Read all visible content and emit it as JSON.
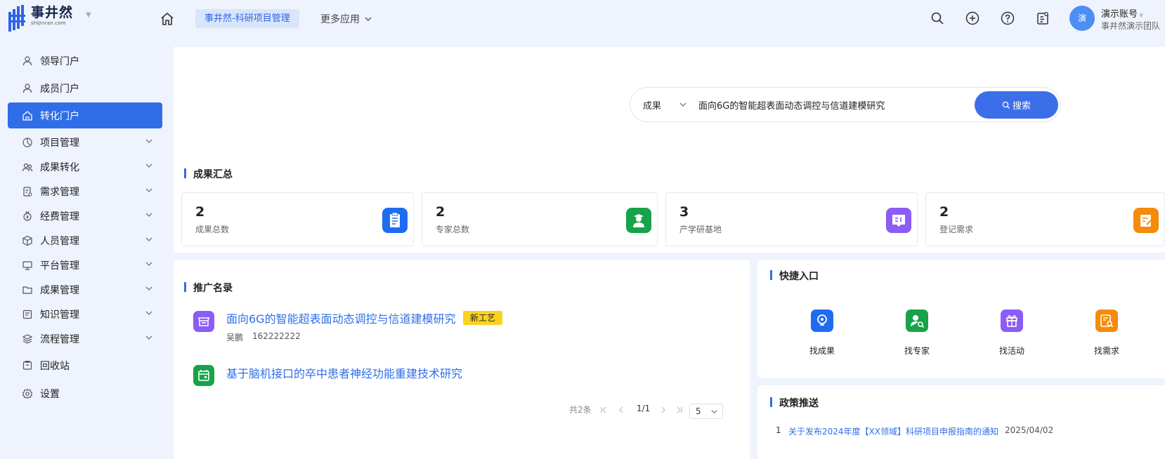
{
  "header": {
    "logo_cn": "事井然",
    "logo_en": "shijinran.com",
    "app_name": "事井然-科研项目管理",
    "more_apps": "更多应用",
    "avatar_text": "演",
    "account_name": "演示账号",
    "account_team": "事井然演示团队"
  },
  "sidebar": {
    "items": [
      {
        "label": "领导门户",
        "icon": "person-icon",
        "expandable": false,
        "active": false
      },
      {
        "label": "成员门户",
        "icon": "person-icon",
        "expandable": false,
        "active": false
      },
      {
        "label": "转化门户",
        "icon": "home-icon",
        "expandable": false,
        "active": true
      },
      {
        "label": "项目管理",
        "icon": "pie-icon",
        "expandable": true,
        "active": false
      },
      {
        "label": "成果转化",
        "icon": "group-icon",
        "expandable": true,
        "active": false
      },
      {
        "label": "需求管理",
        "icon": "doc-icon",
        "expandable": true,
        "active": false
      },
      {
        "label": "经费管理",
        "icon": "money-icon",
        "expandable": true,
        "active": false
      },
      {
        "label": "人员管理",
        "icon": "cube-icon",
        "expandable": true,
        "active": false
      },
      {
        "label": "平台管理",
        "icon": "monitor-icon",
        "expandable": true,
        "active": false
      },
      {
        "label": "成果管理",
        "icon": "folder-icon",
        "expandable": true,
        "active": false
      },
      {
        "label": "知识管理",
        "icon": "book-icon",
        "expandable": true,
        "active": false
      },
      {
        "label": "流程管理",
        "icon": "layers-icon",
        "expandable": true,
        "active": false
      },
      {
        "label": "回收站",
        "icon": "trash-icon",
        "expandable": false,
        "active": false
      },
      {
        "label": "设置",
        "icon": "gear-icon",
        "expandable": false,
        "active": false
      }
    ]
  },
  "search": {
    "category": "成果",
    "query": "面向6G的智能超表面动态调控与信道建模研究",
    "button_label": "搜索"
  },
  "summary": {
    "title": "成果汇总",
    "cards": [
      {
        "value": "2",
        "label": "成果总数",
        "color": "#1f6cf0",
        "icon": "clipboard-icon"
      },
      {
        "value": "2",
        "label": "专家总数",
        "color": "#17a34a",
        "icon": "expert-icon"
      },
      {
        "value": "3",
        "label": "产学研基地",
        "color": "#8b5cf6",
        "icon": "base-icon"
      },
      {
        "value": "2",
        "label": "登记需求",
        "color": "#f58a0b",
        "icon": "edit-icon"
      }
    ]
  },
  "promotion": {
    "title": "推广名录",
    "items": [
      {
        "title": "面向6G的智能超表面动态调控与信道建模研究",
        "tag": "新工艺",
        "author": "吴鹏",
        "phone": "162222222",
        "color": "#8b5cf6",
        "icon": "store-icon"
      },
      {
        "title": "基于脑机接口的卒中患者神经功能重建技术研究",
        "tag": "",
        "author": "",
        "phone": "",
        "color": "#17a34a",
        "icon": "calendar-icon"
      }
    ],
    "pager": {
      "total": "共2条",
      "page": "1/1",
      "size": "5"
    }
  },
  "quick": {
    "title": "快捷入口",
    "items": [
      {
        "label": "找成果",
        "color": "#1f6cf0",
        "icon": "bulb-icon"
      },
      {
        "label": "找专家",
        "color": "#17a34a",
        "icon": "expert-search-icon"
      },
      {
        "label": "找活动",
        "color": "#8b5cf6",
        "icon": "gift-icon"
      },
      {
        "label": "找需求",
        "color": "#f58a0b",
        "icon": "demand-search-icon"
      }
    ]
  },
  "policy": {
    "title": "政策推送",
    "items": [
      {
        "index": "1",
        "title": "关于发布2024年度【XX领域】科研项目申报指南的通知",
        "date": "2025/04/02"
      }
    ]
  }
}
